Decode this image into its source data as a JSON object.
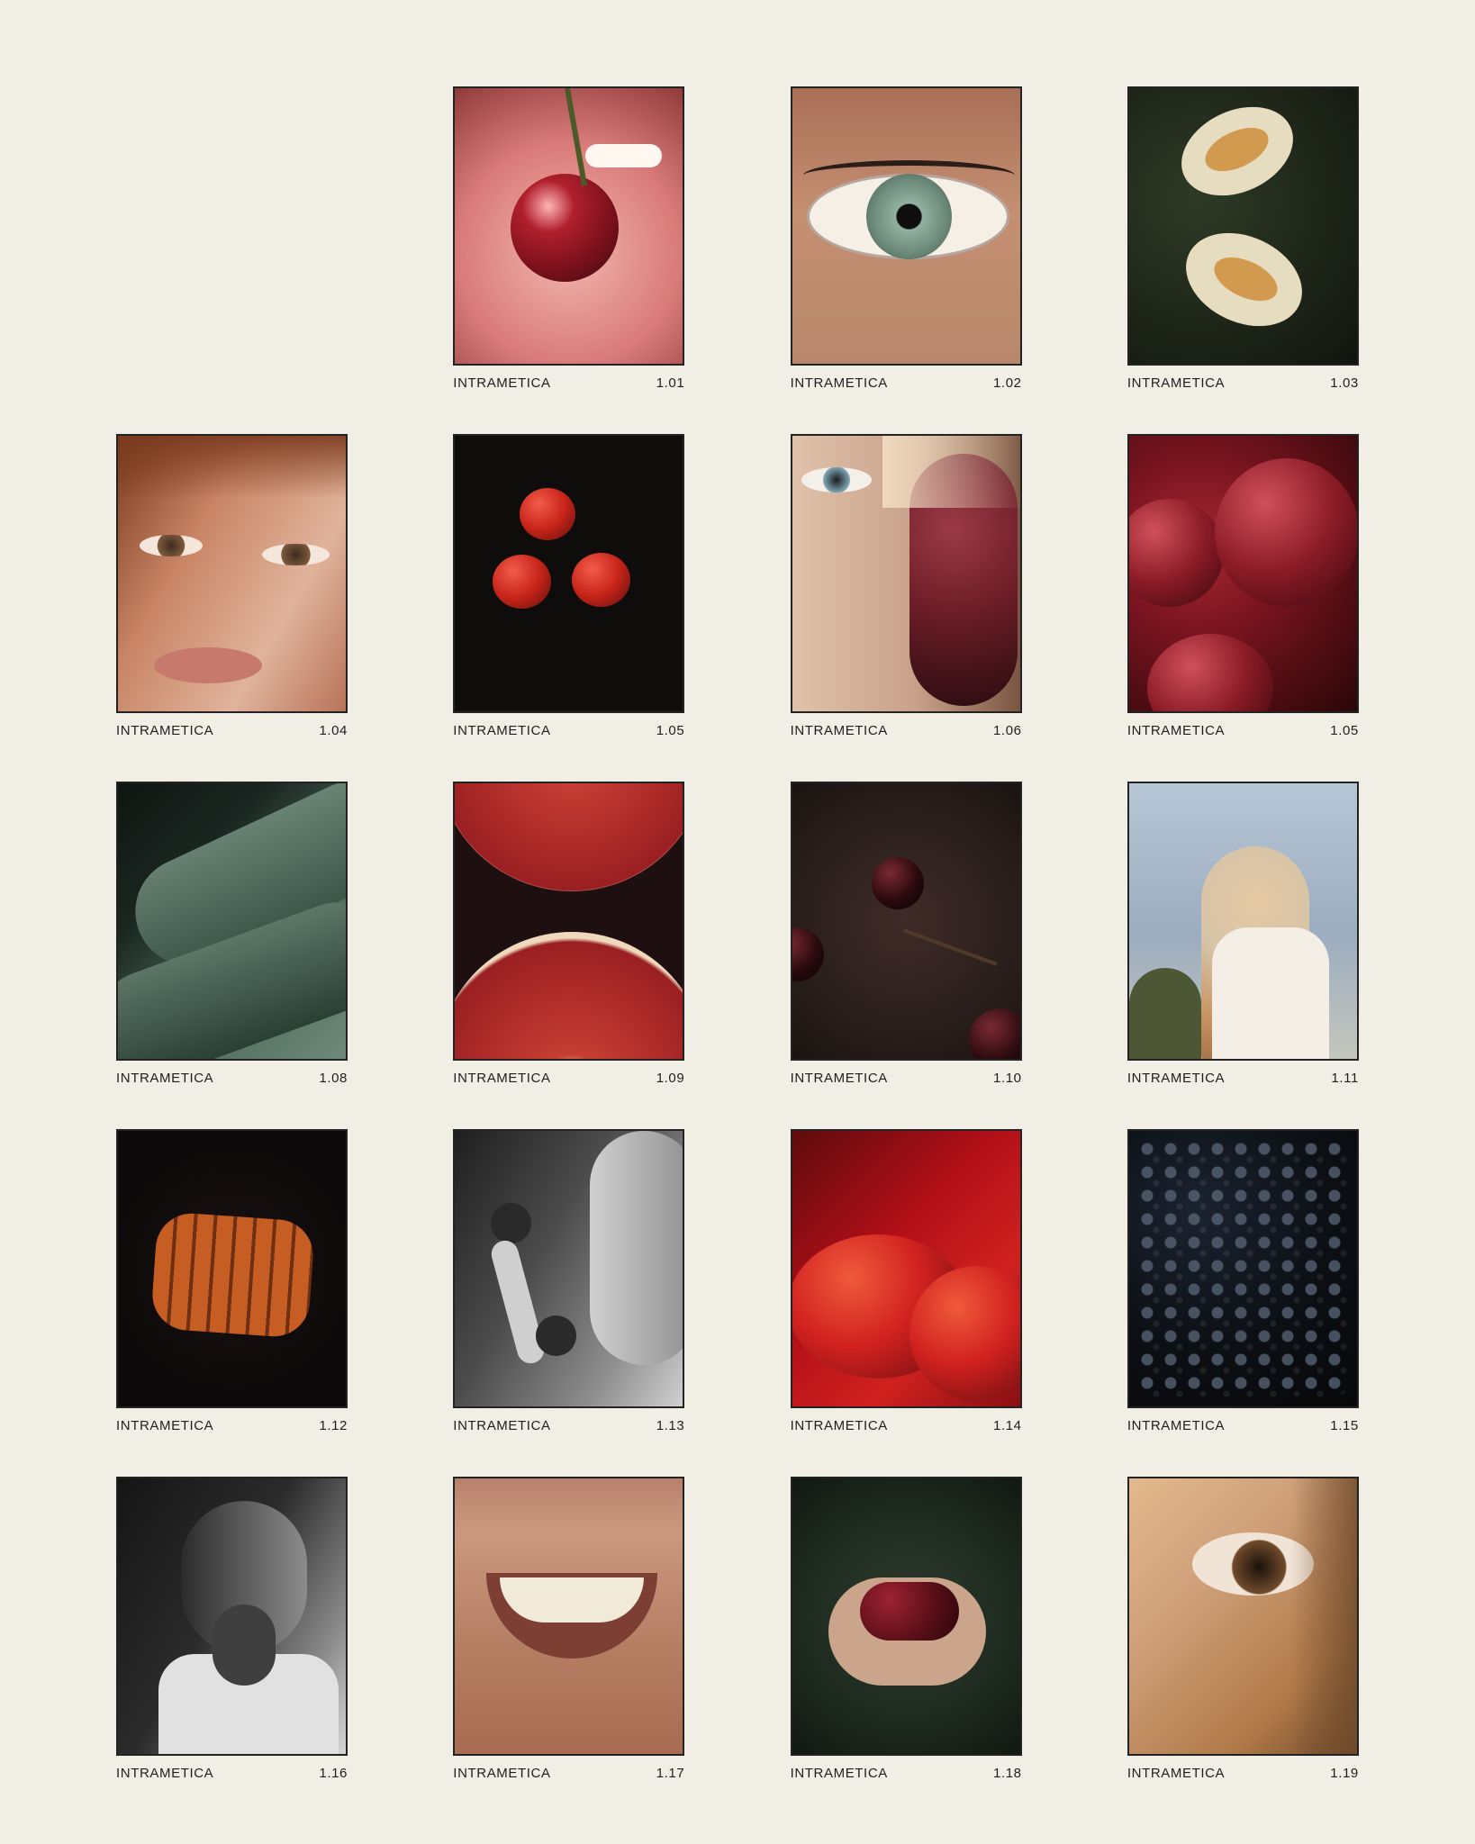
{
  "brand": "INTRAMETICA",
  "grid": [
    {
      "label": "",
      "code": ""
    },
    {
      "label": "INTRAMETICA",
      "code": "1.01",
      "image": "lips-cherry",
      "colors": {
        "bg": "#d97b7a",
        "mid": "#f4b1aa",
        "accent": "#7d111c",
        "shade": "#2a1112"
      }
    },
    {
      "label": "INTRAMETICA",
      "code": "1.02",
      "image": "eye",
      "colors": {
        "bg": "#b8876b",
        "mid": "#d0a384",
        "accent": "#92b1a0",
        "shade": "#4e3127"
      }
    },
    {
      "label": "INTRAMETICA",
      "code": "1.03",
      "image": "melon",
      "colors": {
        "bg": "#1d2417",
        "mid": "#44513a",
        "accent": "#e6dcc0",
        "shade": "#d19a4e"
      }
    },
    {
      "label": "INTRAMETICA",
      "code": "1.04",
      "image": "face-redhead",
      "colors": {
        "bg": "#c98566",
        "mid": "#e0b39b",
        "accent": "#7a3a1e",
        "shade": "#4f2c22"
      }
    },
    {
      "label": "INTRAMETICA",
      "code": "1.05",
      "image": "tomatoes",
      "colors": {
        "bg": "#0f0c0c",
        "mid": "#3a0a0a",
        "accent": "#c82419",
        "shade": "#5c100d"
      }
    },
    {
      "label": "INTRAMETICA",
      "code": "1.06",
      "image": "woman-grapes",
      "colors": {
        "bg": "#c7a088",
        "mid": "#e1c2ab",
        "accent": "#6c1d27",
        "shade": "#3b2020"
      }
    },
    {
      "label": "INTRAMETICA",
      "code": "1.05",
      "image": "plums",
      "colors": {
        "bg": "#5b0b12",
        "mid": "#7d1521",
        "accent": "#a52a33",
        "shade": "#2a0608"
      }
    },
    {
      "label": "INTRAMETICA",
      "code": "1.08",
      "image": "aloe",
      "colors": {
        "bg": "#1a2621",
        "mid": "#496657",
        "accent": "#6f8a7b",
        "shade": "#0f1512"
      }
    },
    {
      "label": "INTRAMETICA",
      "code": "1.09",
      "image": "grapefruit",
      "colors": {
        "bg": "#2a1616",
        "mid": "#c63d33",
        "accent": "#f0d8bd",
        "shade": "#9a1f22"
      }
    },
    {
      "label": "INTRAMETICA",
      "code": "1.10",
      "image": "cherries-dark",
      "colors": {
        "bg": "#2a1f1c",
        "mid": "#3f2b27",
        "accent": "#2a0a0d",
        "shade": "#4f3a2b"
      }
    },
    {
      "label": "INTRAMETICA",
      "code": "1.11",
      "image": "woman-sky",
      "colors": {
        "bg": "#9cadc0",
        "mid": "#d6c4a7",
        "accent": "#c79461",
        "shade": "#4d5735"
      }
    },
    {
      "label": "INTRAMETICA",
      "code": "1.12",
      "image": "carrots",
      "colors": {
        "bg": "#0b0909",
        "mid": "#1c1412",
        "accent": "#c65d22",
        "shade": "#6e2f12"
      }
    },
    {
      "label": "INTRAMETICA",
      "code": "1.13",
      "image": "bw-raspberries",
      "colors": {
        "bg": "#4b4b4b",
        "mid": "#8d8d8d",
        "accent": "#d0d0d0",
        "shade": "#1f1f1f"
      }
    },
    {
      "label": "INTRAMETICA",
      "code": "1.14",
      "image": "red-tomato",
      "colors": {
        "bg": "#b10f18",
        "mid": "#d0211f",
        "accent": "#f05a3b",
        "shade": "#5f0b0d"
      }
    },
    {
      "label": "INTRAMETICA",
      "code": "1.15",
      "image": "blackberries",
      "colors": {
        "bg": "#0c0f14",
        "mid": "#1b2330",
        "accent": "#5b6779",
        "shade": "#070809"
      }
    },
    {
      "label": "INTRAMETICA",
      "code": "1.16",
      "image": "bw-woman",
      "colors": {
        "bg": "#2b2b2b",
        "mid": "#8c8c8c",
        "accent": "#e1e1e1",
        "shade": "#151515"
      }
    },
    {
      "label": "INTRAMETICA",
      "code": "1.17",
      "image": "smile",
      "colors": {
        "bg": "#b57f64",
        "mid": "#d6a48a",
        "accent": "#f2ead8",
        "shade": "#7d3f33"
      }
    },
    {
      "label": "INTRAMETICA",
      "code": "1.18",
      "image": "hands-cherries",
      "colors": {
        "bg": "#1e2a1f",
        "mid": "#2d3b2d",
        "accent": "#5a0f18",
        "shade": "#caa58b"
      }
    },
    {
      "label": "INTRAMETICA",
      "code": "1.19",
      "image": "eye-closeup",
      "colors": {
        "bg": "#b07948",
        "mid": "#cfa07a",
        "accent": "#6f4a2b",
        "shade": "#e4b98d"
      }
    }
  ]
}
